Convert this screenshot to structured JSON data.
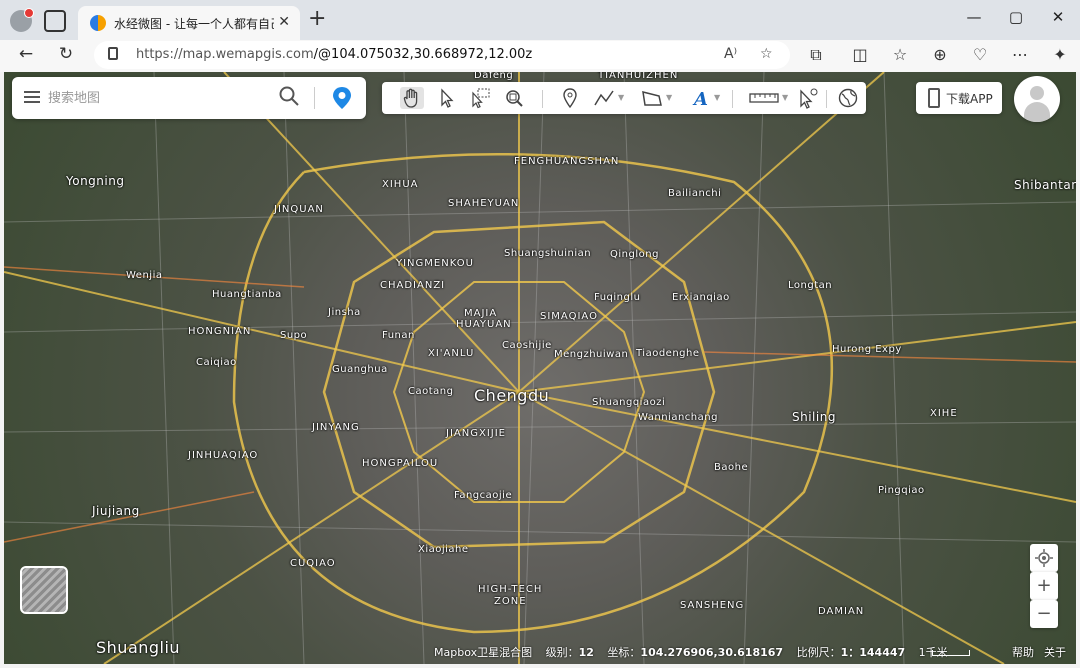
{
  "browser": {
    "tab_title": "水经微图 - 让每一个人都有自己的",
    "url_host": "https://map.wemapgis.com",
    "url_path": "/@104.075032,30.668972,12.00z"
  },
  "search": {
    "placeholder": "搜索地图"
  },
  "download_app": {
    "label": "下载APP"
  },
  "status": {
    "source": "Mapbox卫星混合图",
    "level_label": "级别：",
    "level": "12",
    "coord_label": "坐标：",
    "coord": "104.276906,30.618167",
    "scale_label": "比例尺：",
    "scale": "1：144447",
    "scale_unit": "1千米"
  },
  "footer": {
    "help": "帮助",
    "about": "关于"
  },
  "map_labels": [
    {
      "text": "Dafeng"
    },
    {
      "text": "TIANHUIZHEN"
    },
    {
      "text": "Yongning"
    },
    {
      "text": "FENGHUANGSHAN"
    },
    {
      "text": "XIHUA"
    },
    {
      "text": "SHAHEYUAN"
    },
    {
      "text": "Bailianchi"
    },
    {
      "text": "Shibantan"
    },
    {
      "text": "JINQUAN"
    },
    {
      "text": "Shuangshuinian"
    },
    {
      "text": "Qinglong"
    },
    {
      "text": "YINGMENKOU"
    },
    {
      "text": "Wenjia"
    },
    {
      "text": "CHADIANZI"
    },
    {
      "text": "Longtan"
    },
    {
      "text": "Huangtianba"
    },
    {
      "text": "Fuqinglu"
    },
    {
      "text": "Erxianqiao"
    },
    {
      "text": "Jinsha"
    },
    {
      "text": "MAJIA"
    },
    {
      "text": "HUAYUAN"
    },
    {
      "text": "SIMAQIAO"
    },
    {
      "text": "HONGNIAN"
    },
    {
      "text": "Supo"
    },
    {
      "text": "Funan"
    },
    {
      "text": "Caoshijie"
    },
    {
      "text": "XI'ANLU"
    },
    {
      "text": "Mengzhuiwan"
    },
    {
      "text": "Tiaodenghe"
    },
    {
      "text": "Hurong Expy"
    },
    {
      "text": "Caiqiao"
    },
    {
      "text": "Guanghua"
    },
    {
      "text": "Caotang"
    },
    {
      "text": "Chengdu"
    },
    {
      "text": "Shuangqiaozi"
    },
    {
      "text": "Shiling"
    },
    {
      "text": "XIHE"
    },
    {
      "text": "Wannianchang"
    },
    {
      "text": "JINYANG"
    },
    {
      "text": "JIANGXIJIE"
    },
    {
      "text": "JINHUAQIAO"
    },
    {
      "text": "HONGPAILOU"
    },
    {
      "text": "Baohe"
    },
    {
      "text": "Pingqiao"
    },
    {
      "text": "Fangcaojie"
    },
    {
      "text": "Jiujiang"
    },
    {
      "text": "Xiaojiahe"
    },
    {
      "text": "CUQIAO"
    },
    {
      "text": "HIGH-TECH"
    },
    {
      "text": "ZONE"
    },
    {
      "text": "SANSHENG"
    },
    {
      "text": "DAMIAN"
    },
    {
      "text": "Shuangliu"
    }
  ]
}
